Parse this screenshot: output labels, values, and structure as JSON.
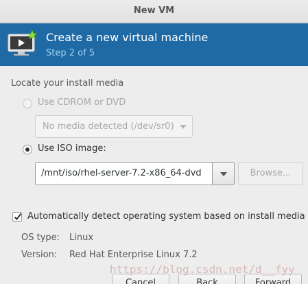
{
  "window": {
    "title": "New VM"
  },
  "header": {
    "title": "Create a new virtual machine",
    "step": "Step 2 of 5",
    "icon": "monitor-star-icon"
  },
  "install_media": {
    "section_label": "Locate your install media",
    "cdrom": {
      "label": "Use CDROM or DVD",
      "selected": false,
      "enabled": false,
      "combo_value": "No media detected (/dev/sr0)"
    },
    "iso": {
      "label": "Use ISO image:",
      "selected": true,
      "path": "/mnt/iso/rhel-server-7.2-x86_64-dvd",
      "browse_label": "Browse..."
    }
  },
  "os_detect": {
    "label": "Automatically detect operating system based on install media",
    "checked": true,
    "os_type_key": "OS type:",
    "os_type_value": "Linux",
    "version_key": "Version:",
    "version_value": "Red Hat Enterprise Linux 7.2"
  },
  "watermark": "https://blog.csdn.net/d__fyy",
  "footer": {
    "cancel_label": "Cancel",
    "back_label": "Back",
    "forward_label": "Forward"
  },
  "colors": {
    "header_bg": "#1f6aa5",
    "step_text": "#9fd0f2",
    "window_bg": "#ededed"
  }
}
